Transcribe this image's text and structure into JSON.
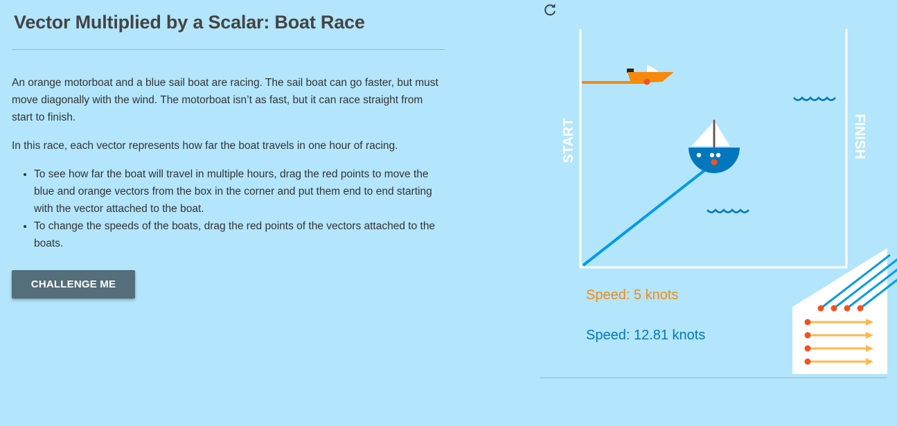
{
  "title": "Vector Multiplied by a Scalar: Boat Race",
  "intro": "An orange motorboat and a blue sail boat are racing. The sail boat can go faster, but must move diagonally with the wind. The motorboat isn’t as fast, but it can race straight from start to finish.",
  "race_note": "In this race, each vector represents how far the boat travels in one hour of racing.",
  "instructions": [
    "To see how far the boat will travel in multiple hours, drag the red points to move the blue and orange vectors from the box in the corner and put them end to end starting with the vector attached to the boat.",
    "To change the speeds of the boats, drag the red points of the vectors attached to the boats."
  ],
  "challenge_button": "CHALLENGE ME",
  "race": {
    "start_label": "START",
    "finish_label": "FINISH",
    "motorboat_speed": "Speed: 5 knots",
    "sailboat_speed": "Speed: 12.81 knots",
    "spare_vectors": {
      "blue_count": 4,
      "orange_count": 4
    }
  },
  "colors": {
    "background": "#b3e5fc",
    "orange": "#f7890c",
    "blue": "#0277bd",
    "point": "#f4511e",
    "button": "#546e7a"
  },
  "icons": {
    "reset": "refresh-icon"
  }
}
